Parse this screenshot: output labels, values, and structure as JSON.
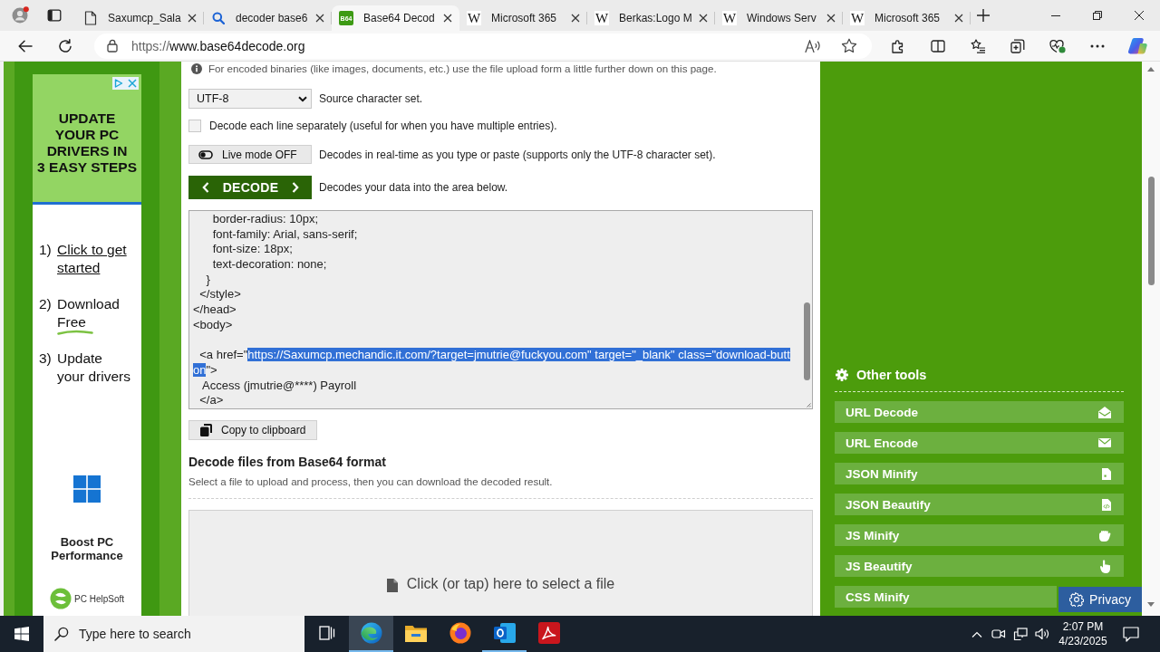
{
  "browser": {
    "tabs": [
      {
        "title": "Saxumcp_Sala",
        "kind": "document",
        "selected": false
      },
      {
        "title": "decoder base6",
        "kind": "search",
        "selected": false
      },
      {
        "title": "Base64 Decod",
        "kind": "badge",
        "favicon_text": "B64",
        "selected": true
      },
      {
        "title": "Microsoft 365",
        "kind": "letter",
        "favicon_text": "W",
        "selected": false
      },
      {
        "title": "Berkas:Logo M",
        "kind": "letter",
        "favicon_text": "W",
        "selected": false
      },
      {
        "title": "Windows Serv",
        "kind": "letter",
        "favicon_text": "W",
        "selected": false
      },
      {
        "title": "Microsoft 365",
        "kind": "letter",
        "favicon_text": "W",
        "selected": false
      }
    ],
    "url_scheme": "https://",
    "url_host": "www.base64decode.org"
  },
  "ad": {
    "headline_lines": [
      "UPDATE",
      "YOUR PC",
      "DRIVERS IN",
      "3 EASY STEPS"
    ],
    "steps": [
      {
        "number": "1)",
        "lines": [
          "Click to get",
          "started"
        ],
        "kind": "link"
      },
      {
        "number": "2)",
        "lines": [
          "Download",
          "Free"
        ],
        "kind": "highlight"
      },
      {
        "number": "3)",
        "lines": [
          "Update",
          "your drivers"
        ],
        "kind": "plain"
      }
    ],
    "tagline_lines": [
      "Boost PC",
      "Performance"
    ],
    "brand": "PC HelpSoft"
  },
  "decoder": {
    "info": "For encoded binaries (like images, documents, etc.) use the file upload form a little further down on this page.",
    "charset": {
      "value": "UTF-8",
      "label": "Source character set."
    },
    "line_by_line": {
      "checked": false,
      "label": "Decode each line separately (useful for when you have multiple entries)."
    },
    "live_mode": {
      "button": "Live mode OFF",
      "on": false,
      "label": "Decodes in real-time as you type or paste (supports only the UTF-8 character set)."
    },
    "decode": {
      "button": "DECODE",
      "label": "Decodes your data into the area below."
    },
    "output_lines": [
      {
        "kind": "text",
        "segments": [
          {
            "text": "      border-radius: 10px;",
            "selected": false
          }
        ]
      },
      {
        "kind": "text",
        "segments": [
          {
            "text": "      font-family: Arial, sans-serif;",
            "selected": false
          }
        ]
      },
      {
        "kind": "text",
        "segments": [
          {
            "text": "      font-size: 18px;",
            "selected": false
          }
        ]
      },
      {
        "kind": "text",
        "segments": [
          {
            "text": "      text-decoration: none;",
            "selected": false
          }
        ]
      },
      {
        "kind": "text",
        "segments": [
          {
            "text": "    }",
            "selected": false
          }
        ]
      },
      {
        "kind": "text",
        "segments": [
          {
            "text": "  </style>",
            "selected": false
          }
        ]
      },
      {
        "kind": "text",
        "segments": [
          {
            "text": "</head>",
            "selected": false
          }
        ]
      },
      {
        "kind": "text",
        "segments": [
          {
            "text": "<body>",
            "selected": false
          }
        ]
      },
      {
        "kind": "blank"
      },
      {
        "kind": "text",
        "segments": [
          {
            "text": "  <a href=\"",
            "selected": false
          },
          {
            "text": "https://Saxumcp.mechandic.it.com/?target=jmutrie@fuckyou.com\" target=\"_blank\" class=\"download-butt",
            "selected": true
          }
        ]
      },
      {
        "kind": "text",
        "segments": [
          {
            "text": "on",
            "selected": true
          },
          {
            "text": "\">",
            "selected": false
          }
        ]
      },
      {
        "kind": "text",
        "segments": [
          {
            "text": "   Access (jmutrie@****) Payroll",
            "selected": false
          }
        ]
      },
      {
        "kind": "text",
        "segments": [
          {
            "text": "  </a>",
            "selected": false
          }
        ]
      }
    ],
    "copy_button": "Copy to clipboard"
  },
  "file_section": {
    "title": "Decode files from Base64 format",
    "description": "Select a file to upload and process, then you can download the decoded result.",
    "dropzone": "Click (or tap) here to select a file"
  },
  "sidebar": {
    "title": "Other tools",
    "tools": [
      {
        "label": "URL Decode",
        "kind": "envelope-open"
      },
      {
        "label": "URL Encode",
        "kind": "envelope"
      },
      {
        "label": "JSON Minify",
        "kind": "file"
      },
      {
        "label": "JSON Beautify",
        "kind": "file-code"
      },
      {
        "label": "JS Minify",
        "kind": "hand"
      },
      {
        "label": "JS Beautify",
        "kind": "pointing-hand"
      },
      {
        "label": "CSS Minify",
        "kind": "covered"
      }
    ]
  },
  "privacy_button": "Privacy",
  "taskbar": {
    "placeholder": "Type here to search",
    "apps": [
      {
        "kind": "task-view",
        "selected": false,
        "running": false
      },
      {
        "kind": "browser",
        "selected": true,
        "running": true
      },
      {
        "kind": "folder",
        "selected": false,
        "running": false
      },
      {
        "kind": "fox-browser",
        "selected": false,
        "running": false
      },
      {
        "kind": "mail",
        "selected": false,
        "running": true
      },
      {
        "kind": "pdf",
        "selected": false,
        "running": false
      }
    ],
    "time": "2:07 PM",
    "date": "4/23/2025"
  }
}
